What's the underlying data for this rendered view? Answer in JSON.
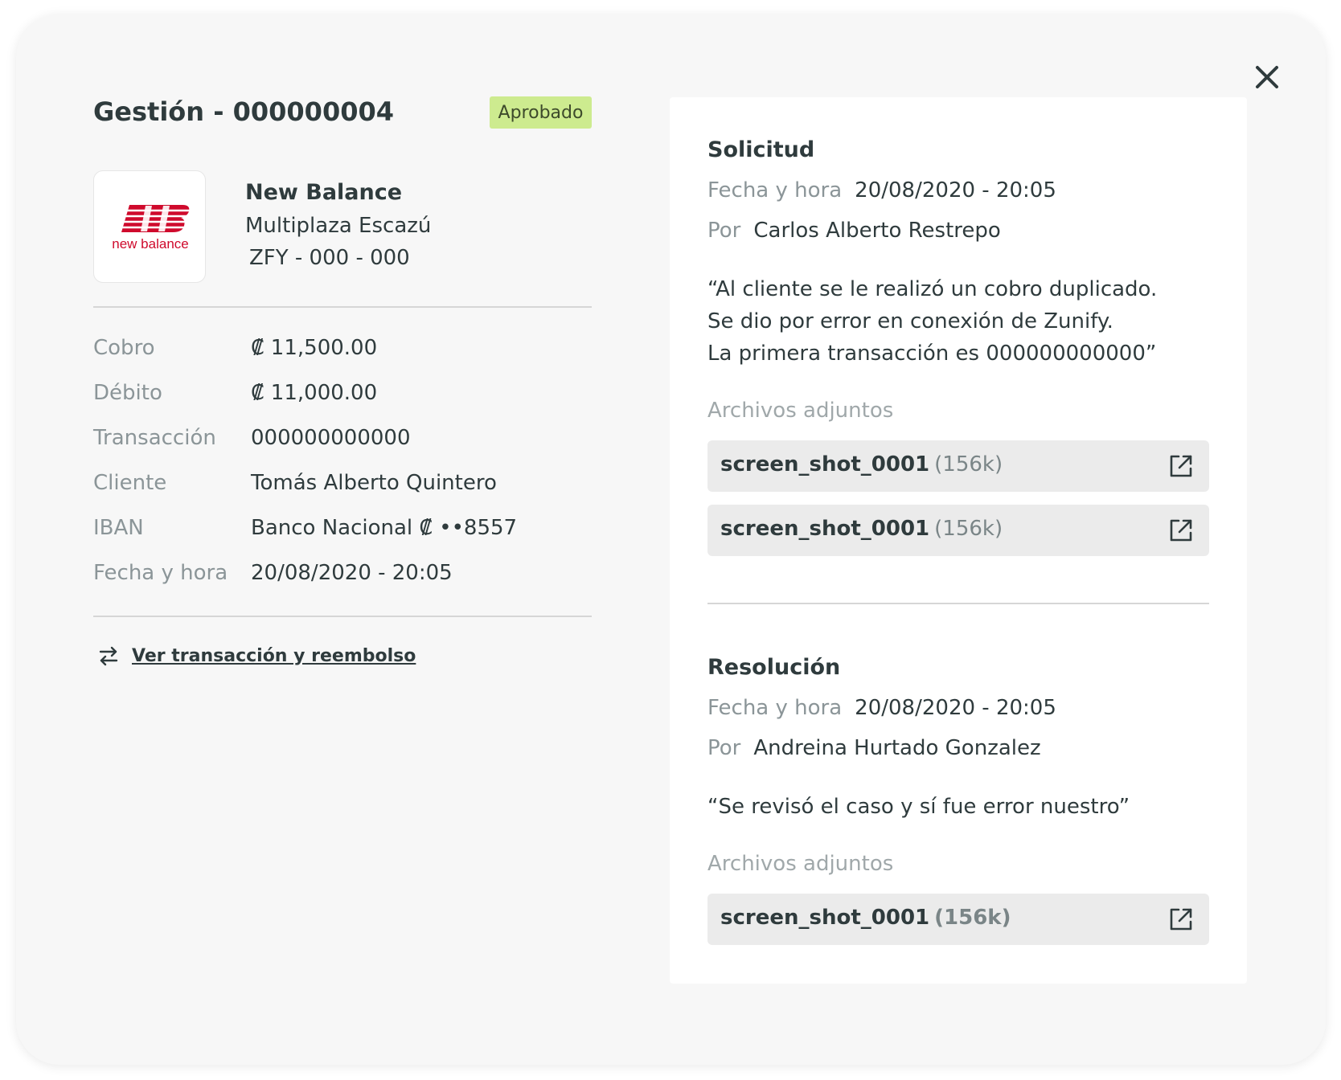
{
  "modal": {
    "title": "Gestión - 000000004",
    "status_badge": "Aprobado",
    "close_icon": "close-icon"
  },
  "store": {
    "logo": "new-balance-logo",
    "logo_text": "new balance",
    "name": "New Balance",
    "location": "Multiplaza Escazú",
    "code": "ZFY - 000 - 000"
  },
  "details": [
    {
      "label": "Cobro",
      "value": "₡ 11,500.00"
    },
    {
      "label": "Débito",
      "value": "₡ 11,000.00"
    },
    {
      "label": "Transacción",
      "value": "000000000000"
    },
    {
      "label": "Cliente",
      "value": "Tomás Alberto Quintero"
    },
    {
      "label": "IBAN",
      "value": "Banco Nacional ₡  ••8557"
    },
    {
      "label": "Fecha y hora",
      "value": "20/08/2020 - 20:05"
    }
  ],
  "link": {
    "icon": "swap-arrows-icon",
    "label": "Ver transacción y reembolso"
  },
  "solicitud": {
    "title": "Solicitud",
    "date_label": "Fecha y hora",
    "date_value": "20/08/2020 - 20:05",
    "by_label": "Por",
    "by_value": "Carlos Alberto Restrepo",
    "quote_lines": [
      "“Al cliente se le realizó un cobro duplicado.",
      "Se dio por error en conexión de Zunify.",
      "La primera transacción es 000000000000”"
    ],
    "attachments_label": "Archivos adjuntos",
    "attachments": [
      {
        "name": "screen_shot_0001",
        "size": "(156k)"
      },
      {
        "name": "screen_shot_0001",
        "size": "(156k)"
      }
    ]
  },
  "resolucion": {
    "title": "Resolución",
    "date_label": "Fecha y hora",
    "date_value": "20/08/2020 - 20:05",
    "by_label": "Por",
    "by_value": "Andreina Hurtado Gonzalez",
    "quote": "“Se revisó el caso y sí fue error nuestro”",
    "attachments_label": "Archivos adjuntos",
    "attachments": [
      {
        "name": "screen_shot_0001",
        "size": "(156k)"
      }
    ]
  },
  "colors": {
    "badge_bg": "#cdeb8f",
    "brand_red": "#cf0a2c",
    "text_dark": "#2f3b3d",
    "text_muted": "#8b9598"
  }
}
